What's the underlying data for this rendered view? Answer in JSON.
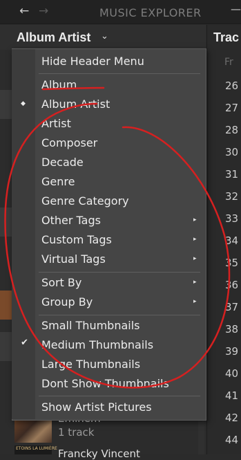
{
  "titlebar": {
    "back": "←",
    "forward": "→",
    "title": "MUSIC EXPLORER",
    "minimize": "—"
  },
  "panel": {
    "header_label": "Album Artist",
    "caret": "⌄"
  },
  "right": {
    "header": "Trac",
    "subheader": "Fr",
    "numbers": [
      "26",
      "27",
      "28",
      "30",
      "31",
      "32",
      "33",
      "34",
      "35",
      "36",
      "37",
      "38",
      "39",
      "40",
      "41",
      "42",
      "44"
    ]
  },
  "menu": {
    "hide_header": "Hide Header Menu",
    "album": "Album",
    "album_artist": "Album Artist",
    "artist": "Artist",
    "composer": "Composer",
    "decade": "Decade",
    "genre": "Genre",
    "genre_category": "Genre Category",
    "other_tags": "Other Tags",
    "custom_tags": "Custom Tags",
    "virtual_tags": "Virtual Tags",
    "sort_by": "Sort By",
    "group_by": "Group By",
    "small_thumbnails": "Small Thumbnails",
    "medium_thumbnails": "Medium Thumbnails",
    "large_thumbnails": "Large Thumbnails",
    "dont_show_thumbnails": "Dont Show Thumbnails",
    "show_artist_pictures": "Show Artist Pictures",
    "radio_mark": "◆",
    "check_mark": "✔",
    "submenu_arrow": "▸"
  },
  "list": {
    "item1_title": "Eminem",
    "item1_sub": "1 track",
    "item2_title": "Francky Vincent",
    "thumb2_text": "ETOINS LA LUMIÈRE"
  },
  "annotation_color": "#d62020"
}
